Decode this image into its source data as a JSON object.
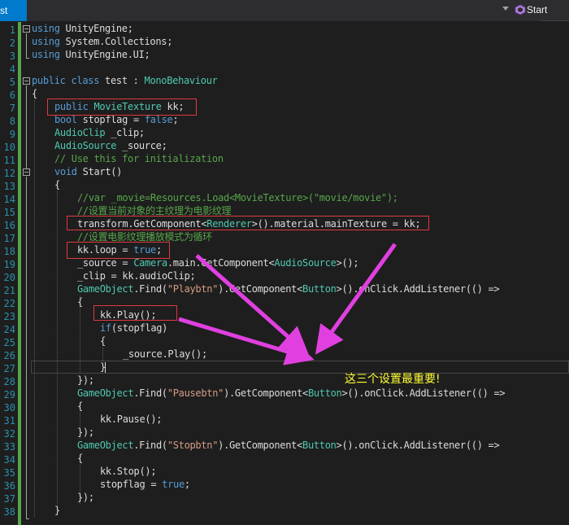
{
  "tab": {
    "active_label": "st"
  },
  "member_dropdown": {
    "label": "Start"
  },
  "line_numbers": [
    "1",
    "2",
    "3",
    "4",
    "5",
    "6",
    "7",
    "8",
    "9",
    "10",
    "11",
    "12",
    "13",
    "14",
    "15",
    "16",
    "17",
    "18",
    "19",
    "20",
    "21",
    "22",
    "23",
    "24",
    "25",
    "26",
    "27",
    "28",
    "29",
    "30",
    "31",
    "32",
    "33",
    "34",
    "35",
    "36",
    "37",
    "38"
  ],
  "annotation": {
    "text": "这三个设置最重要!"
  },
  "colors": {
    "arrow": "#e040e0",
    "highlight_box": "#e0393e",
    "annotation_text": "#ffff33",
    "keyword": "#569cd6",
    "type": "#4ec9b0",
    "comment": "#57a64a",
    "string": "#d69d85"
  },
  "code": {
    "l1": [
      "using",
      " UnityEngine;"
    ],
    "l2": [
      "using",
      " System.Collections;"
    ],
    "l3": [
      "using",
      " UnityEngine.UI;"
    ],
    "l5": [
      "public",
      " ",
      "class",
      " test : ",
      "MonoBehaviour"
    ],
    "l6": [
      "{"
    ],
    "l7": [
      "public",
      " ",
      "MovieTexture",
      " kk;"
    ],
    "l8": [
      "bool",
      " stopflag = ",
      "false",
      ";"
    ],
    "l9": [
      "AudioClip",
      " _clip;"
    ],
    "l10": [
      "AudioSource",
      " _source;"
    ],
    "l11": [
      "// Use this for initialization"
    ],
    "l12": [
      "void",
      " Start()"
    ],
    "l13": [
      "{"
    ],
    "l14": [
      "//var _movie=Resources.Load<MovieTexture>(\"movie/movie\");"
    ],
    "l15": [
      "//设置当前对象的主纹理为电影纹理"
    ],
    "l16": [
      "transform.GetComponent<",
      "Renderer",
      ">().material.mainTexture = kk;"
    ],
    "l17": [
      "//设置电影纹理播放模式为循环"
    ],
    "l18": [
      "kk.loop = ",
      "true",
      ";"
    ],
    "l19": [
      "_source = ",
      "Camera",
      ".main.GetComponent<",
      "AudioSource",
      ">();"
    ],
    "l20": [
      "_clip = kk.audioClip;"
    ],
    "l21": [
      "GameObject",
      ".Find(",
      "\"Playbtn\"",
      ").GetComponent<",
      "Button",
      ">().onClick.AddListener(() =>"
    ],
    "l22": [
      "{"
    ],
    "l23": [
      "kk.Play();"
    ],
    "l24": [
      "if",
      "(stopflag)"
    ],
    "l25": [
      "{"
    ],
    "l26": [
      "_source.Play();"
    ],
    "l27": [
      "}"
    ],
    "l28": [
      "});"
    ],
    "l29": [
      "GameObject",
      ".Find(",
      "\"Pausebtn\"",
      ").GetComponent<",
      "Button",
      ">().onClick.AddListener(() =>"
    ],
    "l30": [
      "{"
    ],
    "l31": [
      "kk.Pause();"
    ],
    "l32": [
      "});"
    ],
    "l33": [
      "GameObject",
      ".Find(",
      "\"Stopbtn\"",
      ").GetComponent<",
      "Button",
      ">().onClick.AddListener(() =>"
    ],
    "l34": [
      "{"
    ],
    "l35": [
      "kk.Stop();"
    ],
    "l36": [
      "stopflag = ",
      "true",
      ";"
    ],
    "l37": [
      "});"
    ],
    "l38": [
      "}"
    ]
  }
}
